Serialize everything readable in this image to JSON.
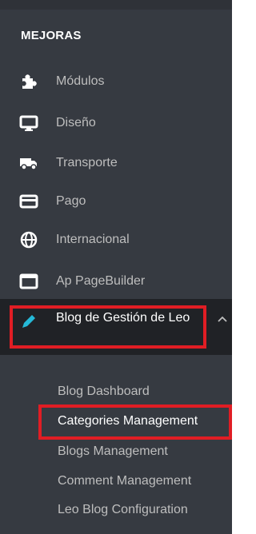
{
  "section": {
    "title": "MEJORAS"
  },
  "menu": [
    {
      "label": "Módulos",
      "icon": "puzzle-icon"
    },
    {
      "label": "Diseño",
      "icon": "monitor-icon"
    },
    {
      "label": "Transporte",
      "icon": "truck-icon"
    },
    {
      "label": "Pago",
      "icon": "credit-card-icon"
    },
    {
      "label": "Internacional",
      "icon": "globe-icon"
    },
    {
      "label": "Ap PageBuilder",
      "icon": "window-icon"
    }
  ],
  "active": {
    "label": "Blog de Gestión de Leo",
    "icon": "pencil-icon"
  },
  "submenu": [
    {
      "label": "Blog Dashboard"
    },
    {
      "label": "Categories Management"
    },
    {
      "label": "Blogs Management"
    },
    {
      "label": "Comment Management"
    },
    {
      "label": "Leo Blog Configuration"
    }
  ],
  "colors": {
    "sidebar_bg": "#363a41",
    "active_bg": "#202226",
    "highlight_border": "#e01d24",
    "text": "#bebebe",
    "active_text": "#ffffff",
    "accent_icon": "#25b9d7"
  }
}
